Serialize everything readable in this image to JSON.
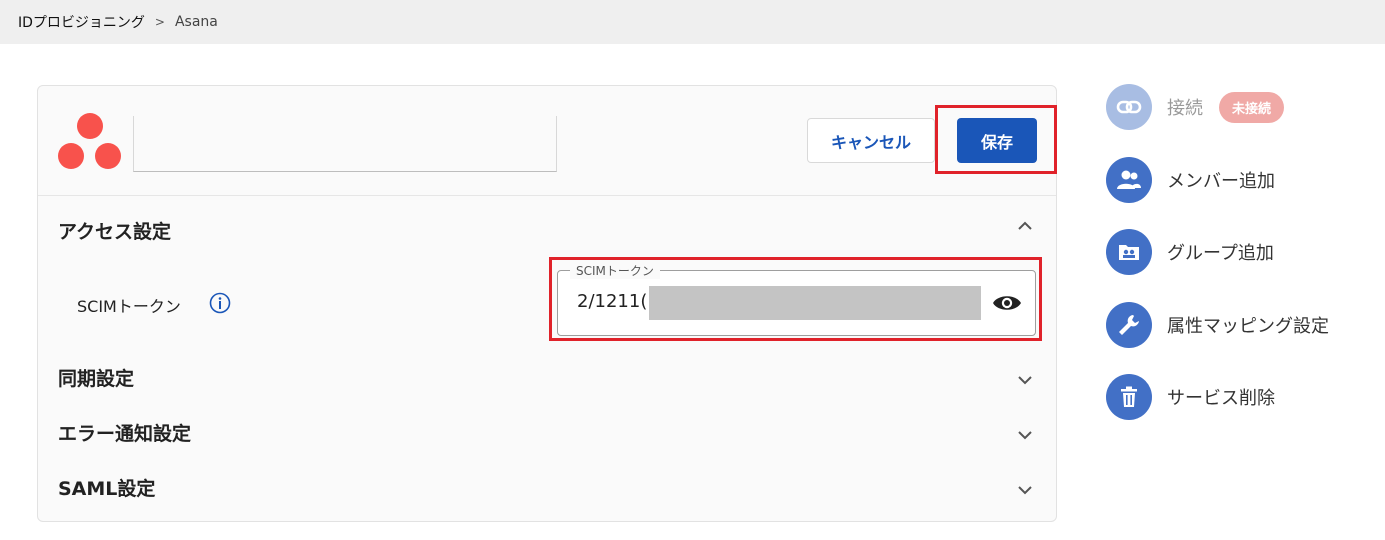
{
  "breadcrumb": {
    "root": "IDプロビジョニング",
    "separator": ">",
    "current": "Asana"
  },
  "header": {
    "cancel_label": "キャンセル",
    "save_label": "保存",
    "logo_icon": "asana-logo"
  },
  "sections": {
    "access": {
      "title": "アクセス設定",
      "expanded": true
    },
    "sync": {
      "title": "同期設定"
    },
    "error_notify": {
      "title": "エラー通知設定"
    },
    "saml": {
      "title": "SAML設定"
    }
  },
  "scim": {
    "row_label": "SCIMトークン",
    "field_label": "SCIMトークン",
    "value_prefix": "2/1211("
  },
  "sidebar": {
    "connection": {
      "label": "接続",
      "status": "未接続",
      "icon": "link-icon"
    },
    "add_member": {
      "label": "メンバー追加",
      "icon": "users-icon"
    },
    "add_group": {
      "label": "グループ追加",
      "icon": "group-folder-icon"
    },
    "attr_mapping": {
      "label": "属性マッピング設定",
      "icon": "wrench-icon"
    },
    "delete_service": {
      "label": "サービス削除",
      "icon": "trash-icon"
    }
  },
  "colors": {
    "primary": "#1a56b8",
    "asana": "#f8524c",
    "highlight": "#e0222a",
    "badge": "#f0a9a6"
  }
}
